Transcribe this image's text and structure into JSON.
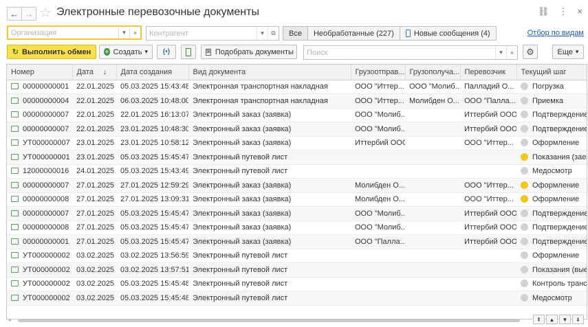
{
  "window": {
    "title": "Электронные перевозочные документы",
    "back": "←",
    "forward": "→",
    "star": "☆",
    "link_icon": "⛓",
    "more_icon": "⋮",
    "close_icon": "×"
  },
  "filters": {
    "organization_placeholder": "Организация",
    "contractor_placeholder": "Контрагент",
    "dropdown_glyph": "▾",
    "clear_glyph": "×",
    "open_glyph": "⧉",
    "segments": {
      "all": "Все",
      "unprocessed": "Необработанные (227)",
      "new_messages": "Новые сообщения (4)"
    },
    "view_link": "Отбор по видам"
  },
  "toolbar": {
    "exchange_label": "Выполнить обмен",
    "exchange_icon": "↻",
    "create_label": "Создать",
    "create_arrow": "▾",
    "radio_label": "(•)",
    "pick_label": "Подобрать документы",
    "search_placeholder": "Поиск",
    "gear_icon": "⚙",
    "more_label": "Еще",
    "more_arrow": "▾"
  },
  "table": {
    "columns": {
      "number": "Номер",
      "date": "Дата",
      "date_sort": "↓",
      "created": "Дата создания",
      "doctype": "Вид документа",
      "shipper": "Грузоотправ...",
      "consignee": "Грузополуча...",
      "carrier": "Перевозчик",
      "step": "Текущий шаг"
    },
    "rows": [
      {
        "number": "00000000001",
        "date": "22.01.2025",
        "created": "05.03.2025 15:43:48",
        "doctype": "Электронная транспортная накладная",
        "shipper": "ООО \"Иттер...",
        "consignee": "ООО \"Молиб...",
        "carrier": "Палладий О...",
        "step": "Погрузка",
        "status": "grey"
      },
      {
        "number": "00000000004",
        "date": "22.01.2025",
        "created": "06.03.2025 10:48:00",
        "doctype": "Электронная транспортная накладная",
        "shipper": "ООО \"Иттер...",
        "consignee": "Молибден О...",
        "carrier": "ООО \"Палла...",
        "step": "Приемка",
        "status": "grey"
      },
      {
        "number": "00000000007",
        "date": "22.01.2025",
        "created": "22.01.2025 16:13:07",
        "doctype": "Электронный заказ (заявка)",
        "shipper": "ООО \"Молиб...",
        "consignee": "",
        "carrier": "Иттербий ООО",
        "step": "Подтверждение",
        "status": "grey"
      },
      {
        "number": "00000000007",
        "date": "22.01.2025",
        "created": "23.01.2025 10:48:30",
        "doctype": "Электронный заказ (заявка)",
        "shipper": "ООО \"Молиб...",
        "consignee": "",
        "carrier": "Иттербий ООО",
        "step": "Подтверждение",
        "status": "grey"
      },
      {
        "number": "УТ000000007",
        "date": "23.01.2025",
        "created": "23.01.2025 10:58:12",
        "doctype": "Электронный заказ (заявка)",
        "shipper": "Иттербий ООО",
        "consignee": "",
        "carrier": "ООО \"Иттер...",
        "step": "Оформление",
        "status": "grey"
      },
      {
        "number": "УТ000000001",
        "date": "23.01.2025",
        "created": "05.03.2025 15:45:47",
        "doctype": "Электронный путевой лист",
        "shipper": "",
        "consignee": "",
        "carrier": "",
        "step": "Показания (заезд)",
        "status": "yellow"
      },
      {
        "number": "12000000016",
        "date": "24.01.2025",
        "created": "05.03.2025 15:43:49",
        "doctype": "Электронный путевой лист",
        "shipper": "",
        "consignee": "",
        "carrier": "",
        "step": "Медосмотр",
        "status": "grey"
      },
      {
        "number": "00000000007",
        "date": "27.01.2025",
        "created": "27.01.2025 12:59:29",
        "doctype": "Электронный заказ (заявка)",
        "shipper": "Молибден О...",
        "consignee": "",
        "carrier": "ООО \"Иттер...",
        "step": "Оформление",
        "status": "yellow"
      },
      {
        "number": "00000000008",
        "date": "27.01.2025",
        "created": "27.01.2025 13:09:31",
        "doctype": "Электронный заказ (заявка)",
        "shipper": "Молибден О...",
        "consignee": "",
        "carrier": "ООО \"Иттер...",
        "step": "Оформление",
        "status": "yellow"
      },
      {
        "number": "00000000007",
        "date": "27.01.2025",
        "created": "05.03.2025 15:45:47",
        "doctype": "Электронный заказ (заявка)",
        "shipper": "ООО \"Молиб...",
        "consignee": "",
        "carrier": "Иттербий ООО",
        "step": "Подтверждение",
        "status": "grey"
      },
      {
        "number": "00000000008",
        "date": "27.01.2025",
        "created": "05.03.2025 15:45:47",
        "doctype": "Электронный заказ (заявка)",
        "shipper": "ООО \"Молиб...",
        "consignee": "",
        "carrier": "Иттербий ООО",
        "step": "Подтверждение",
        "status": "grey"
      },
      {
        "number": "00000000001",
        "date": "27.01.2025",
        "created": "05.03.2025 15:45:47",
        "doctype": "Электронный заказ (заявка)",
        "shipper": "ООО \"Палла...",
        "consignee": "",
        "carrier": "Иттербий ООО",
        "step": "Подтверждение",
        "status": "grey"
      },
      {
        "number": "УТ000000002",
        "date": "03.02.2025",
        "created": "03.02.2025 13:56:59",
        "doctype": "Электронный путевой лист",
        "shipper": "",
        "consignee": "",
        "carrier": "",
        "step": "Оформление",
        "status": "grey"
      },
      {
        "number": "УТ000000002",
        "date": "03.02.2025",
        "created": "03.02.2025 13:57:51",
        "doctype": "Электронный путевой лист",
        "shipper": "",
        "consignee": "",
        "carrier": "",
        "step": "Показания (выезд)",
        "status": "grey"
      },
      {
        "number": "УТ000000002",
        "date": "03.02.2025",
        "created": "05.03.2025 15:45:48",
        "doctype": "Электронный путевой лист",
        "shipper": "",
        "consignee": "",
        "carrier": "",
        "step": "Контроль транспорта",
        "status": "grey"
      },
      {
        "number": "УТ000000002",
        "date": "03.02.2025",
        "created": "05.03.2025 15:45:48",
        "doctype": "Электронный путевой лист",
        "shipper": "",
        "consignee": "",
        "carrier": "",
        "step": "Медосмотр",
        "status": "grey"
      }
    ]
  },
  "scroll": {
    "left_arrow": "◂",
    "right_arrow": "▸",
    "first": "⇞",
    "up": "▲",
    "down": "▼",
    "last": "⇟"
  }
}
